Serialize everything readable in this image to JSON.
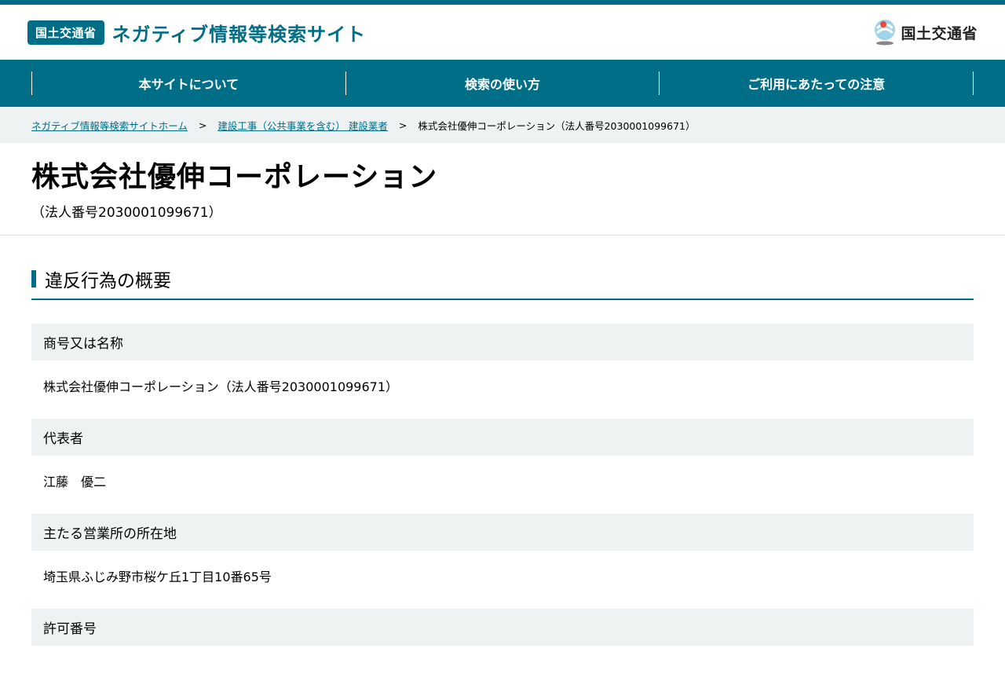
{
  "header": {
    "badge": "国土交通省",
    "site_title": "ネガティブ情報等検索サイト",
    "ministry_name": "国土交通省"
  },
  "nav": {
    "items": [
      "本サイトについて",
      "検索の使い方",
      "ご利用にあたっての注意"
    ]
  },
  "breadcrumb": {
    "home": "ネガティブ情報等検索サイトホーム",
    "category": "建設工事（公共事業を含む） 建設業者",
    "current": "株式会社優伸コーポレーション（法人番号2030001099671）",
    "separator": ">"
  },
  "page": {
    "title": "株式会社優伸コーポレーション",
    "corp_number": "（法人番号2030001099671）"
  },
  "section": {
    "title": "違反行為の概要"
  },
  "fields": [
    {
      "label": "商号又は名称",
      "value": "株式会社優伸コーポレーション（法人番号2030001099671）"
    },
    {
      "label": "代表者",
      "value": "江藤　優二"
    },
    {
      "label": "主たる営業所の所在地",
      "value": "埼玉県ふじみ野市桜ケ丘1丁目10番65号"
    },
    {
      "label": "許可番号",
      "value": ""
    }
  ],
  "colors": {
    "primary": "#006e87",
    "light_bg": "#eef2f3"
  }
}
